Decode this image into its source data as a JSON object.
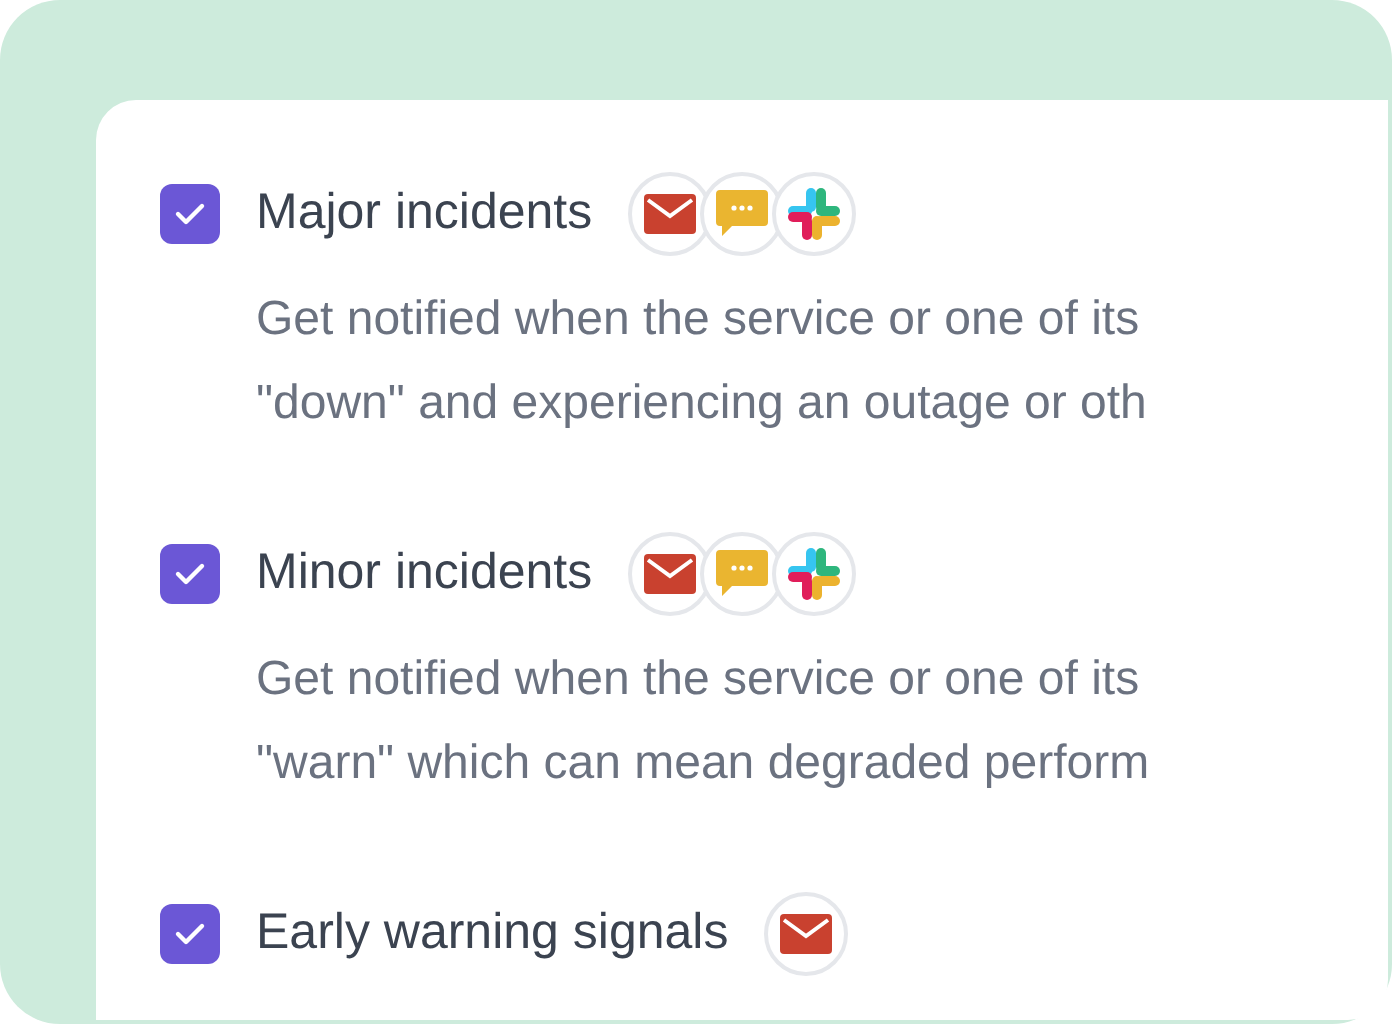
{
  "alerts": [
    {
      "title": "Major incidents",
      "checked": true,
      "channels": [
        {
          "kind": "email"
        },
        {
          "kind": "chat"
        },
        {
          "kind": "slack"
        }
      ],
      "description": [
        "Get notified when the service or one of its",
        "\"down\" and experiencing an outage or oth"
      ]
    },
    {
      "title": "Minor incidents",
      "checked": true,
      "channels": [
        {
          "kind": "email"
        },
        {
          "kind": "chat"
        },
        {
          "kind": "slack"
        }
      ],
      "description": [
        "Get notified when the service or one of its",
        "\"warn\" which can mean degraded perform"
      ]
    },
    {
      "title": "Early warning signals",
      "checked": true,
      "channels": [
        {
          "kind": "email"
        }
      ]
    }
  ]
}
